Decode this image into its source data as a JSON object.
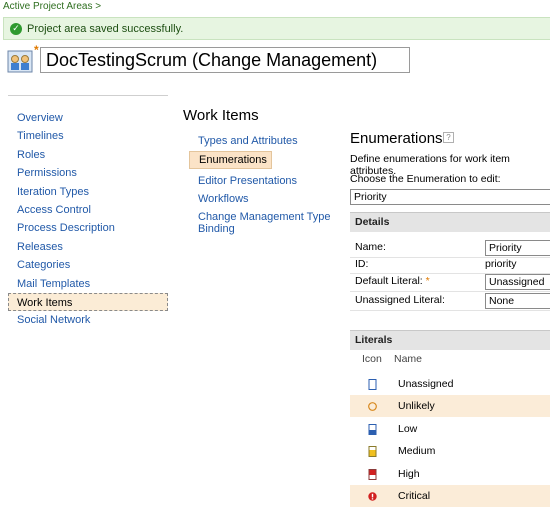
{
  "breadcrumb": "Active Project Areas >",
  "banner": {
    "message": "Project area saved successfully."
  },
  "project": {
    "name": "DocTestingScrum (Change Management)",
    "dirty_marker": "*"
  },
  "left_nav": [
    "Overview",
    "Timelines",
    "Roles",
    "Permissions",
    "Iteration Types",
    "Access Control",
    "Process Description",
    "Releases",
    "Categories",
    "Mail Templates",
    "Work Items",
    "Social Network"
  ],
  "left_nav_active": "Work Items",
  "section_title": "Work Items",
  "sub_nav": [
    "Types and Attributes",
    "Enumerations",
    "Editor Presentations",
    "Workflows",
    "Change Management Type Binding"
  ],
  "sub_nav_active": "Enumerations",
  "enumerations": {
    "title": "Enumerations",
    "help": "?",
    "description": "Define enumerations for work item attributes.",
    "choose_label": "Choose the Enumeration to edit:",
    "selected": "Priority"
  },
  "details": {
    "header": "Details",
    "name_label": "Name:",
    "name_value": "Priority",
    "id_label": "ID:",
    "id_value": "priority",
    "default_label": "Default Literal:",
    "default_required": "*",
    "default_value": "Unassigned",
    "unassigned_label": "Unassigned Literal:",
    "unassigned_value": "None"
  },
  "literals": {
    "header": "Literals",
    "col_icon": "Icon",
    "col_name": "Name",
    "rows": [
      {
        "name": "Unassigned",
        "icon": "empty-bar-icon"
      },
      {
        "name": "Unlikely",
        "icon": "circle-outline-icon"
      },
      {
        "name": "Low",
        "icon": "low-bar-icon"
      },
      {
        "name": "Medium",
        "icon": "medium-bar-icon"
      },
      {
        "name": "High",
        "icon": "high-bar-icon"
      },
      {
        "name": "Critical",
        "icon": "critical-alert-icon"
      }
    ]
  },
  "colors": {
    "link": "#2159a8",
    "banner_bg": "#e7f5e1",
    "highlight": "#fbecd8",
    "critical": "#d22020"
  }
}
